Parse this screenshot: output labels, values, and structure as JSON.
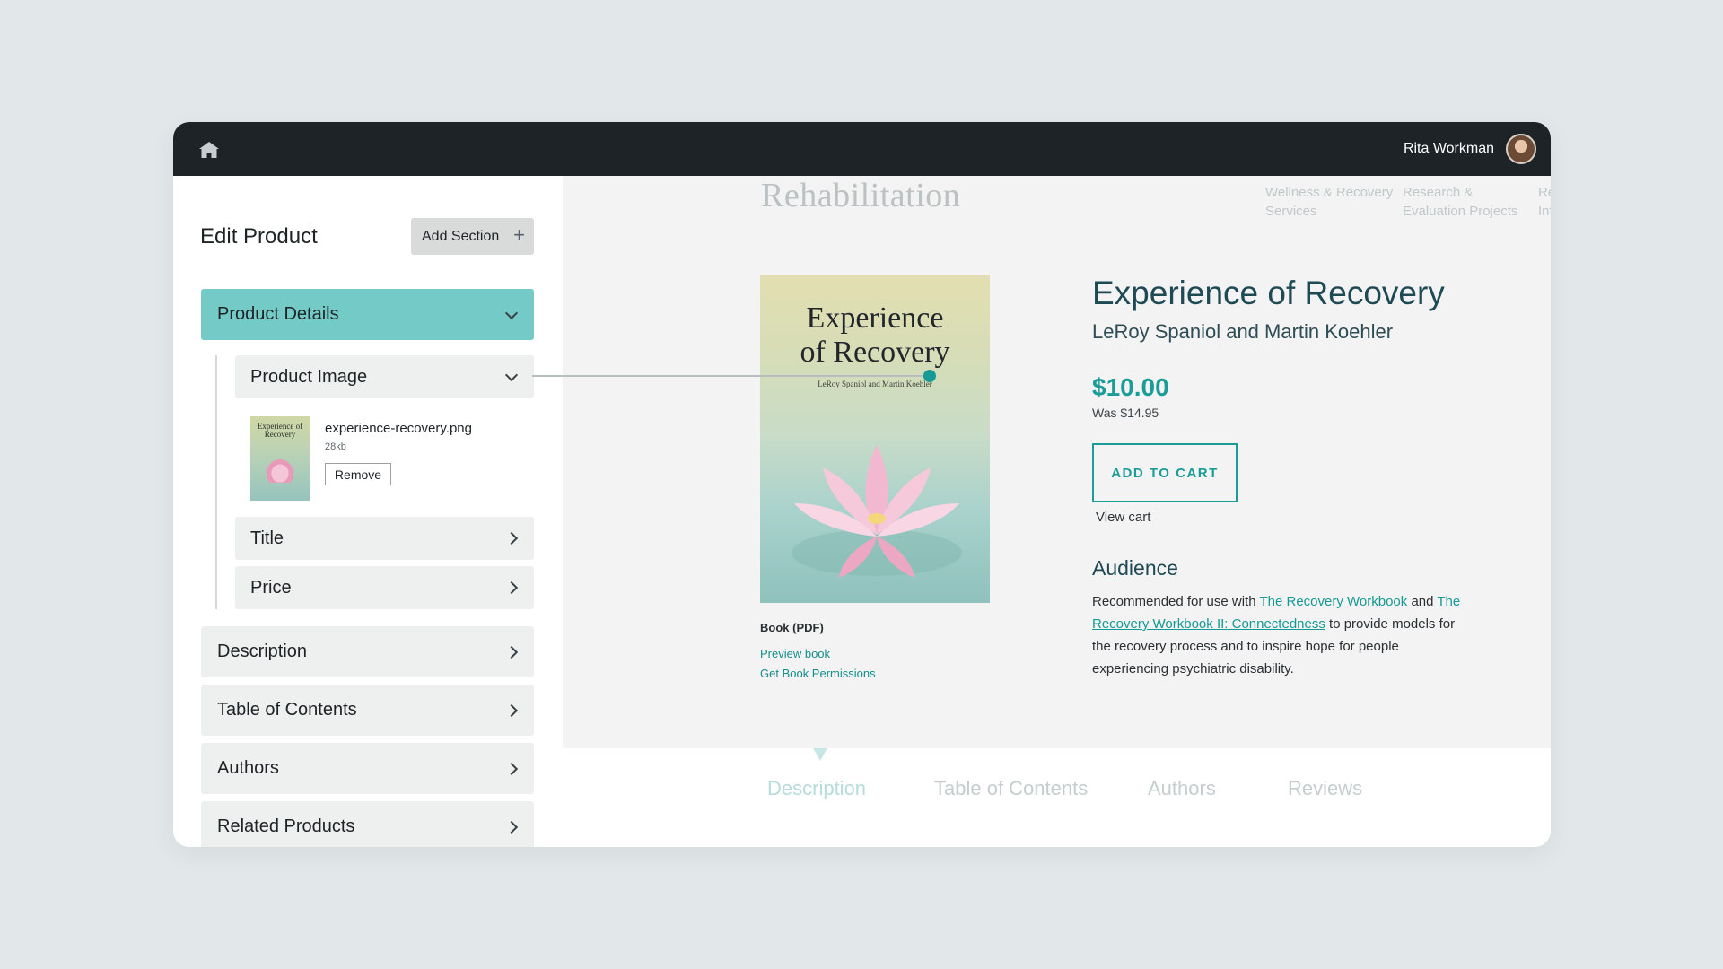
{
  "topbar": {
    "user_name": "Rita Workman"
  },
  "editor": {
    "title": "Edit Product",
    "add_section_label": "Add Section",
    "sections": {
      "product_details": "Product Details",
      "product_image": "Product Image",
      "title": "Title",
      "price": "Price",
      "description": "Description",
      "table_of_contents": "Table of Contents",
      "authors": "Authors",
      "related_products": "Related Products"
    },
    "image_file": {
      "name": "experience-recovery.png",
      "size": "28kb",
      "remove_label": "Remove",
      "thumb_title": "Experience of Recovery"
    }
  },
  "preview": {
    "brand": "Rehabilitation",
    "nav": [
      "Wellness & Recovery Services",
      "Research & Evaluation Projects",
      "Resources & Information"
    ],
    "cover": {
      "title_line1": "Experience",
      "title_line2": "of Recovery",
      "authors": "LeRoy Spaniol and Martin Koehler"
    },
    "book_format": "Book (PDF)",
    "preview_link": "Preview book",
    "permissions_link": "Get Book Permissions",
    "product": {
      "title": "Experience of Recovery",
      "authors": "LeRoy Spaniol and Martin Koehler",
      "price": "$10.00",
      "was_price": "Was $14.95",
      "add_to_cart": "ADD TO CART",
      "view_cart": "View cart"
    },
    "audience": {
      "heading": "Audience",
      "text_before": "Recommended for use with ",
      "link1": "The Recovery Workbook",
      "text_mid": " and ",
      "link2": "The Recovery Workbook II: Connectedness",
      "text_after": " to provide models for the recovery process and to inspire hope for people experiencing psychiatric disability."
    },
    "tabs": [
      "Description",
      "Table of Contents",
      "Authors",
      "Reviews"
    ]
  },
  "colors": {
    "accent": "#1a9c98",
    "panel_active": "#74cac7",
    "topbar": "#1d2327"
  }
}
